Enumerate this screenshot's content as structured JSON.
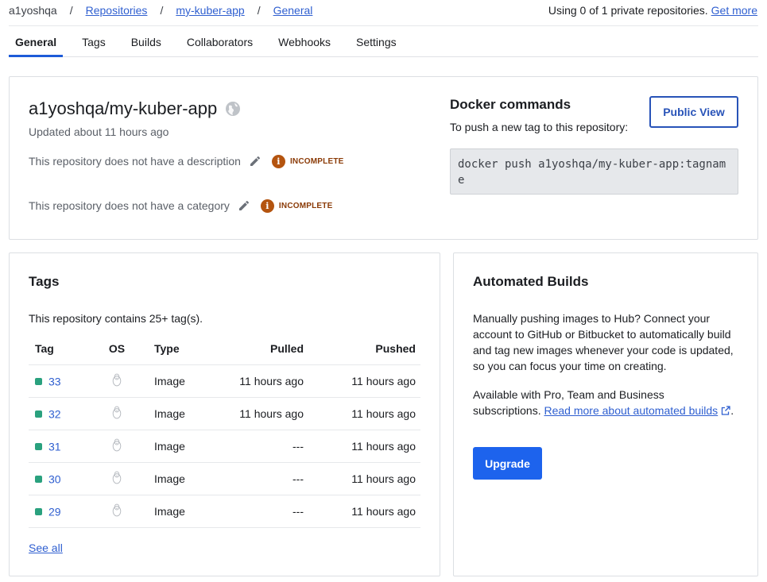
{
  "breadcrumb": {
    "namespace": "a1yoshqa",
    "separator": "/",
    "repositories": "Repositories",
    "repo": "my-kuber-app",
    "current": "General"
  },
  "usage": {
    "text": "Using 0 of 1 private repositories.",
    "link": "Get more"
  },
  "tabs": [
    {
      "label": "General",
      "active": true
    },
    {
      "label": "Tags"
    },
    {
      "label": "Builds"
    },
    {
      "label": "Collaborators"
    },
    {
      "label": "Webhooks"
    },
    {
      "label": "Settings"
    }
  ],
  "repo": {
    "name": "a1yoshqa/my-kuber-app",
    "visibility_icon": "globe-icon",
    "updated": "Updated about 11 hours ago",
    "description_text": "This repository does not have a description",
    "category_text": "This repository does not have a category",
    "incomplete_label": "INCOMPLETE",
    "incomplete_icon_glyph": "i"
  },
  "docker": {
    "title": "Docker commands",
    "subtitle": "To push a new tag to this repository:",
    "command": "docker push a1yoshqa/my-kuber-app:tagname",
    "public_view": "Public View"
  },
  "tags": {
    "title": "Tags",
    "count_text": "This repository contains 25+ tag(s).",
    "columns": [
      "Tag",
      "OS",
      "Type",
      "Pulled",
      "Pushed"
    ],
    "rows": [
      {
        "tag": "33",
        "os": "linux-icon",
        "type": "Image",
        "pulled": "11 hours ago",
        "pushed": "11 hours ago"
      },
      {
        "tag": "32",
        "os": "linux-icon",
        "type": "Image",
        "pulled": "11 hours ago",
        "pushed": "11 hours ago"
      },
      {
        "tag": "31",
        "os": "linux-icon",
        "type": "Image",
        "pulled": "---",
        "pushed": "11 hours ago"
      },
      {
        "tag": "30",
        "os": "linux-icon",
        "type": "Image",
        "pulled": "---",
        "pushed": "11 hours ago"
      },
      {
        "tag": "29",
        "os": "linux-icon",
        "type": "Image",
        "pulled": "---",
        "pushed": "11 hours ago"
      }
    ],
    "see_all": "See all"
  },
  "automated_builds": {
    "title": "Automated Builds",
    "paragraph1": "Manually pushing images to Hub? Connect your account to GitHub or Bitbucket to automatically build and tag new images whenever your code is updated, so you can focus your time on creating.",
    "paragraph2_text": "Available with Pro, Team and Business subscriptions.",
    "paragraph2_link": "Read more about automated builds",
    "paragraph2_end": ".",
    "upgrade": "Upgrade"
  },
  "colors": {
    "link": "#2f5fd0",
    "tab_active": "#1e5bd8",
    "primary_button": "#1d63ed",
    "incomplete": "#b4540f",
    "tag_dot": "#2aa17e"
  }
}
